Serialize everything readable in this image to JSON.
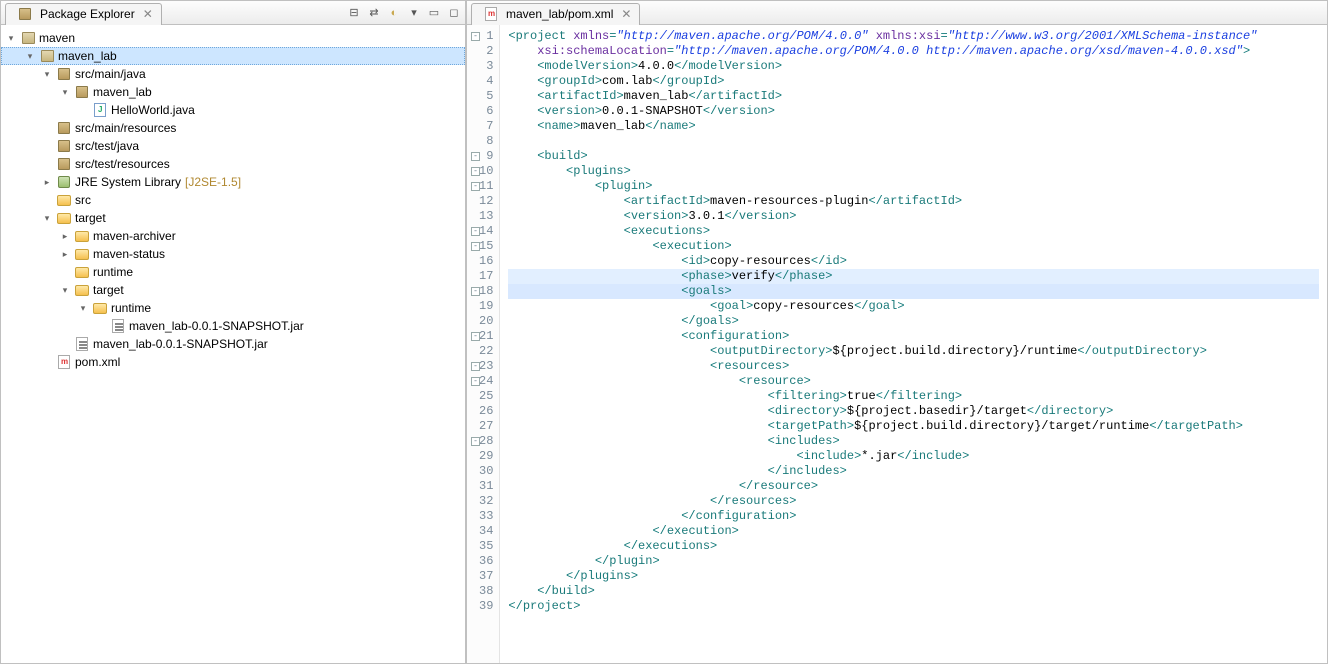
{
  "left": {
    "title": "Package Explorer",
    "toolbar": [
      "collapse-all",
      "link-editor",
      "view-menu",
      "minimize",
      "maximize"
    ]
  },
  "tree": [
    {
      "d": 0,
      "exp": "open",
      "icon": "project",
      "label": "maven"
    },
    {
      "d": 1,
      "exp": "open",
      "icon": "project",
      "label": "maven_lab",
      "sel": true
    },
    {
      "d": 2,
      "exp": "open",
      "icon": "pkg",
      "label": "src/main/java"
    },
    {
      "d": 3,
      "exp": "open",
      "icon": "pkg",
      "label": "maven_lab"
    },
    {
      "d": 4,
      "exp": "leaf",
      "icon": "java",
      "label": "HelloWorld.java"
    },
    {
      "d": 2,
      "exp": "leaf",
      "icon": "pkg",
      "label": "src/main/resources"
    },
    {
      "d": 2,
      "exp": "leaf",
      "icon": "pkg",
      "label": "src/test/java"
    },
    {
      "d": 2,
      "exp": "leaf",
      "icon": "pkg",
      "label": "src/test/resources"
    },
    {
      "d": 2,
      "exp": "closed",
      "icon": "lib",
      "label": "JRE System Library",
      "decor": "[J2SE-1.5]"
    },
    {
      "d": 2,
      "exp": "leaf",
      "icon": "folder",
      "label": "src"
    },
    {
      "d": 2,
      "exp": "open",
      "icon": "folder-open",
      "label": "target"
    },
    {
      "d": 3,
      "exp": "closed",
      "icon": "folder",
      "label": "maven-archiver"
    },
    {
      "d": 3,
      "exp": "closed",
      "icon": "folder",
      "label": "maven-status"
    },
    {
      "d": 3,
      "exp": "leaf",
      "icon": "folder",
      "label": "runtime"
    },
    {
      "d": 3,
      "exp": "open",
      "icon": "folder-open",
      "label": "target"
    },
    {
      "d": 4,
      "exp": "open",
      "icon": "folder-open",
      "label": "runtime"
    },
    {
      "d": 5,
      "exp": "leaf",
      "icon": "jar",
      "label": "maven_lab-0.0.1-SNAPSHOT.jar"
    },
    {
      "d": 3,
      "exp": "leaf",
      "icon": "jar",
      "label": "maven_lab-0.0.1-SNAPSHOT.jar"
    },
    {
      "d": 2,
      "exp": "leaf",
      "icon": "xml",
      "label": "pom.xml"
    }
  ],
  "editor": {
    "tab_icon": "xml",
    "tab_title": "maven_lab/pom.xml",
    "highlight_lines": [
      17,
      18
    ],
    "lines": [
      {
        "n": 1,
        "fold": "-",
        "seg": [
          [
            "bracket",
            "<"
          ],
          [
            "tag",
            "project"
          ],
          [
            "txt",
            " "
          ],
          [
            "attr",
            "xmlns"
          ],
          [
            "bracket",
            "="
          ],
          [
            "str",
            "\"http://maven.apache.org/POM/4.0.0\""
          ],
          [
            "txt",
            " "
          ],
          [
            "attr",
            "xmlns:xsi"
          ],
          [
            "bracket",
            "="
          ],
          [
            "str",
            "\"http://www.w3.org/2001/XMLSchema-instance\""
          ]
        ]
      },
      {
        "n": 2,
        "seg": [
          [
            "txt",
            "    "
          ],
          [
            "attr",
            "xsi:schemaLocation"
          ],
          [
            "bracket",
            "="
          ],
          [
            "str",
            "\"http://maven.apache.org/POM/4.0.0 http://maven.apache.org/xsd/maven-4.0.0.xsd\""
          ],
          [
            "bracket",
            ">"
          ]
        ]
      },
      {
        "n": 3,
        "seg": [
          [
            "txt",
            "    "
          ],
          [
            "bracket",
            "<"
          ],
          [
            "tag",
            "modelVersion"
          ],
          [
            "bracket",
            ">"
          ],
          [
            "txt",
            "4.0.0"
          ],
          [
            "bracket",
            "</"
          ],
          [
            "tag",
            "modelVersion"
          ],
          [
            "bracket",
            ">"
          ]
        ]
      },
      {
        "n": 4,
        "seg": [
          [
            "txt",
            "    "
          ],
          [
            "bracket",
            "<"
          ],
          [
            "tag",
            "groupId"
          ],
          [
            "bracket",
            ">"
          ],
          [
            "txt",
            "com.lab"
          ],
          [
            "bracket",
            "</"
          ],
          [
            "tag",
            "groupId"
          ],
          [
            "bracket",
            ">"
          ]
        ]
      },
      {
        "n": 5,
        "seg": [
          [
            "txt",
            "    "
          ],
          [
            "bracket",
            "<"
          ],
          [
            "tag",
            "artifactId"
          ],
          [
            "bracket",
            ">"
          ],
          [
            "txt",
            "maven_lab"
          ],
          [
            "bracket",
            "</"
          ],
          [
            "tag",
            "artifactId"
          ],
          [
            "bracket",
            ">"
          ]
        ]
      },
      {
        "n": 6,
        "seg": [
          [
            "txt",
            "    "
          ],
          [
            "bracket",
            "<"
          ],
          [
            "tag",
            "version"
          ],
          [
            "bracket",
            ">"
          ],
          [
            "txt",
            "0.0.1-SNAPSHOT"
          ],
          [
            "bracket",
            "</"
          ],
          [
            "tag",
            "version"
          ],
          [
            "bracket",
            ">"
          ]
        ]
      },
      {
        "n": 7,
        "seg": [
          [
            "txt",
            "    "
          ],
          [
            "bracket",
            "<"
          ],
          [
            "tag",
            "name"
          ],
          [
            "bracket",
            ">"
          ],
          [
            "txt",
            "maven_lab"
          ],
          [
            "bracket",
            "</"
          ],
          [
            "tag",
            "name"
          ],
          [
            "bracket",
            ">"
          ]
        ]
      },
      {
        "n": 8,
        "seg": []
      },
      {
        "n": 9,
        "fold": "-",
        "seg": [
          [
            "txt",
            "    "
          ],
          [
            "bracket",
            "<"
          ],
          [
            "tag",
            "build"
          ],
          [
            "bracket",
            ">"
          ]
        ]
      },
      {
        "n": 10,
        "fold": "-",
        "seg": [
          [
            "txt",
            "        "
          ],
          [
            "bracket",
            "<"
          ],
          [
            "tag",
            "plugins"
          ],
          [
            "bracket",
            ">"
          ]
        ]
      },
      {
        "n": 11,
        "fold": "-",
        "seg": [
          [
            "txt",
            "            "
          ],
          [
            "bracket",
            "<"
          ],
          [
            "tag",
            "plugin"
          ],
          [
            "bracket",
            ">"
          ]
        ]
      },
      {
        "n": 12,
        "seg": [
          [
            "txt",
            "                "
          ],
          [
            "bracket",
            "<"
          ],
          [
            "tag",
            "artifactId"
          ],
          [
            "bracket",
            ">"
          ],
          [
            "txt",
            "maven-resources-plugin"
          ],
          [
            "bracket",
            "</"
          ],
          [
            "tag",
            "artifactId"
          ],
          [
            "bracket",
            ">"
          ]
        ]
      },
      {
        "n": 13,
        "seg": [
          [
            "txt",
            "                "
          ],
          [
            "bracket",
            "<"
          ],
          [
            "tag",
            "version"
          ],
          [
            "bracket",
            ">"
          ],
          [
            "txt",
            "3.0.1"
          ],
          [
            "bracket",
            "</"
          ],
          [
            "tag",
            "version"
          ],
          [
            "bracket",
            ">"
          ]
        ]
      },
      {
        "n": 14,
        "fold": "-",
        "seg": [
          [
            "txt",
            "                "
          ],
          [
            "bracket",
            "<"
          ],
          [
            "tag",
            "executions"
          ],
          [
            "bracket",
            ">"
          ]
        ]
      },
      {
        "n": 15,
        "fold": "-",
        "seg": [
          [
            "txt",
            "                    "
          ],
          [
            "bracket",
            "<"
          ],
          [
            "tag",
            "execution"
          ],
          [
            "bracket",
            ">"
          ]
        ]
      },
      {
        "n": 16,
        "seg": [
          [
            "txt",
            "                        "
          ],
          [
            "bracket",
            "<"
          ],
          [
            "tag",
            "id"
          ],
          [
            "bracket",
            ">"
          ],
          [
            "txt",
            "copy-resources"
          ],
          [
            "bracket",
            "</"
          ],
          [
            "tag",
            "id"
          ],
          [
            "bracket",
            ">"
          ]
        ]
      },
      {
        "n": 17,
        "seg": [
          [
            "txt",
            "                        "
          ],
          [
            "bracket",
            "<"
          ],
          [
            "tag",
            "phase"
          ],
          [
            "bracket",
            ">"
          ],
          [
            "txt",
            "verify"
          ],
          [
            "bracket",
            "</"
          ],
          [
            "tag",
            "phase"
          ],
          [
            "bracket",
            ">"
          ]
        ]
      },
      {
        "n": 18,
        "fold": "-",
        "seg": [
          [
            "txt",
            "                        "
          ],
          [
            "bracket",
            "<"
          ],
          [
            "tag",
            "goals"
          ],
          [
            "bracket",
            ">"
          ]
        ]
      },
      {
        "n": 19,
        "seg": [
          [
            "txt",
            "                            "
          ],
          [
            "bracket",
            "<"
          ],
          [
            "tag",
            "goal"
          ],
          [
            "bracket",
            ">"
          ],
          [
            "txt",
            "copy-resources"
          ],
          [
            "bracket",
            "</"
          ],
          [
            "tag",
            "goal"
          ],
          [
            "bracket",
            ">"
          ]
        ]
      },
      {
        "n": 20,
        "seg": [
          [
            "txt",
            "                        "
          ],
          [
            "bracket",
            "</"
          ],
          [
            "tag",
            "goals"
          ],
          [
            "bracket",
            ">"
          ]
        ]
      },
      {
        "n": 21,
        "fold": "-",
        "seg": [
          [
            "txt",
            "                        "
          ],
          [
            "bracket",
            "<"
          ],
          [
            "tag",
            "configuration"
          ],
          [
            "bracket",
            ">"
          ]
        ]
      },
      {
        "n": 22,
        "seg": [
          [
            "txt",
            "                            "
          ],
          [
            "bracket",
            "<"
          ],
          [
            "tag",
            "outputDirectory"
          ],
          [
            "bracket",
            ">"
          ],
          [
            "txt",
            "${project.build.directory}/runtime"
          ],
          [
            "bracket",
            "</"
          ],
          [
            "tag",
            "outputDirectory"
          ],
          [
            "bracket",
            ">"
          ]
        ]
      },
      {
        "n": 23,
        "fold": "-",
        "seg": [
          [
            "txt",
            "                            "
          ],
          [
            "bracket",
            "<"
          ],
          [
            "tag",
            "resources"
          ],
          [
            "bracket",
            ">"
          ]
        ]
      },
      {
        "n": 24,
        "fold": "-",
        "seg": [
          [
            "txt",
            "                                "
          ],
          [
            "bracket",
            "<"
          ],
          [
            "tag",
            "resource"
          ],
          [
            "bracket",
            ">"
          ]
        ]
      },
      {
        "n": 25,
        "seg": [
          [
            "txt",
            "                                    "
          ],
          [
            "bracket",
            "<"
          ],
          [
            "tag",
            "filtering"
          ],
          [
            "bracket",
            ">"
          ],
          [
            "txt",
            "true"
          ],
          [
            "bracket",
            "</"
          ],
          [
            "tag",
            "filtering"
          ],
          [
            "bracket",
            ">"
          ]
        ]
      },
      {
        "n": 26,
        "seg": [
          [
            "txt",
            "                                    "
          ],
          [
            "bracket",
            "<"
          ],
          [
            "tag",
            "directory"
          ],
          [
            "bracket",
            ">"
          ],
          [
            "txt",
            "${project.basedir}/target"
          ],
          [
            "bracket",
            "</"
          ],
          [
            "tag",
            "directory"
          ],
          [
            "bracket",
            ">"
          ]
        ]
      },
      {
        "n": 27,
        "seg": [
          [
            "txt",
            "                                    "
          ],
          [
            "bracket",
            "<"
          ],
          [
            "tag",
            "targetPath"
          ],
          [
            "bracket",
            ">"
          ],
          [
            "txt",
            "${project.build.directory}/target/runtime"
          ],
          [
            "bracket",
            "</"
          ],
          [
            "tag",
            "targetPath"
          ],
          [
            "bracket",
            ">"
          ]
        ]
      },
      {
        "n": 28,
        "fold": "-",
        "seg": [
          [
            "txt",
            "                                    "
          ],
          [
            "bracket",
            "<"
          ],
          [
            "tag",
            "includes"
          ],
          [
            "bracket",
            ">"
          ]
        ]
      },
      {
        "n": 29,
        "seg": [
          [
            "txt",
            "                                        "
          ],
          [
            "bracket",
            "<"
          ],
          [
            "tag",
            "include"
          ],
          [
            "bracket",
            ">"
          ],
          [
            "txt",
            "*.jar"
          ],
          [
            "bracket",
            "</"
          ],
          [
            "tag",
            "include"
          ],
          [
            "bracket",
            ">"
          ]
        ]
      },
      {
        "n": 30,
        "seg": [
          [
            "txt",
            "                                    "
          ],
          [
            "bracket",
            "</"
          ],
          [
            "tag",
            "includes"
          ],
          [
            "bracket",
            ">"
          ]
        ]
      },
      {
        "n": 31,
        "seg": [
          [
            "txt",
            "                                "
          ],
          [
            "bracket",
            "</"
          ],
          [
            "tag",
            "resource"
          ],
          [
            "bracket",
            ">"
          ]
        ]
      },
      {
        "n": 32,
        "seg": [
          [
            "txt",
            "                            "
          ],
          [
            "bracket",
            "</"
          ],
          [
            "tag",
            "resources"
          ],
          [
            "bracket",
            ">"
          ]
        ]
      },
      {
        "n": 33,
        "seg": [
          [
            "txt",
            "                        "
          ],
          [
            "bracket",
            "</"
          ],
          [
            "tag",
            "configuration"
          ],
          [
            "bracket",
            ">"
          ]
        ]
      },
      {
        "n": 34,
        "seg": [
          [
            "txt",
            "                    "
          ],
          [
            "bracket",
            "</"
          ],
          [
            "tag",
            "execution"
          ],
          [
            "bracket",
            ">"
          ]
        ]
      },
      {
        "n": 35,
        "seg": [
          [
            "txt",
            "                "
          ],
          [
            "bracket",
            "</"
          ],
          [
            "tag",
            "executions"
          ],
          [
            "bracket",
            ">"
          ]
        ]
      },
      {
        "n": 36,
        "seg": [
          [
            "txt",
            "            "
          ],
          [
            "bracket",
            "</"
          ],
          [
            "tag",
            "plugin"
          ],
          [
            "bracket",
            ">"
          ]
        ]
      },
      {
        "n": 37,
        "seg": [
          [
            "txt",
            "        "
          ],
          [
            "bracket",
            "</"
          ],
          [
            "tag",
            "plugins"
          ],
          [
            "bracket",
            ">"
          ]
        ]
      },
      {
        "n": 38,
        "seg": [
          [
            "txt",
            "    "
          ],
          [
            "bracket",
            "</"
          ],
          [
            "tag",
            "build"
          ],
          [
            "bracket",
            ">"
          ]
        ]
      },
      {
        "n": 39,
        "seg": [
          [
            "bracket",
            "</"
          ],
          [
            "tag",
            "project"
          ],
          [
            "bracket",
            ">"
          ]
        ]
      }
    ]
  }
}
